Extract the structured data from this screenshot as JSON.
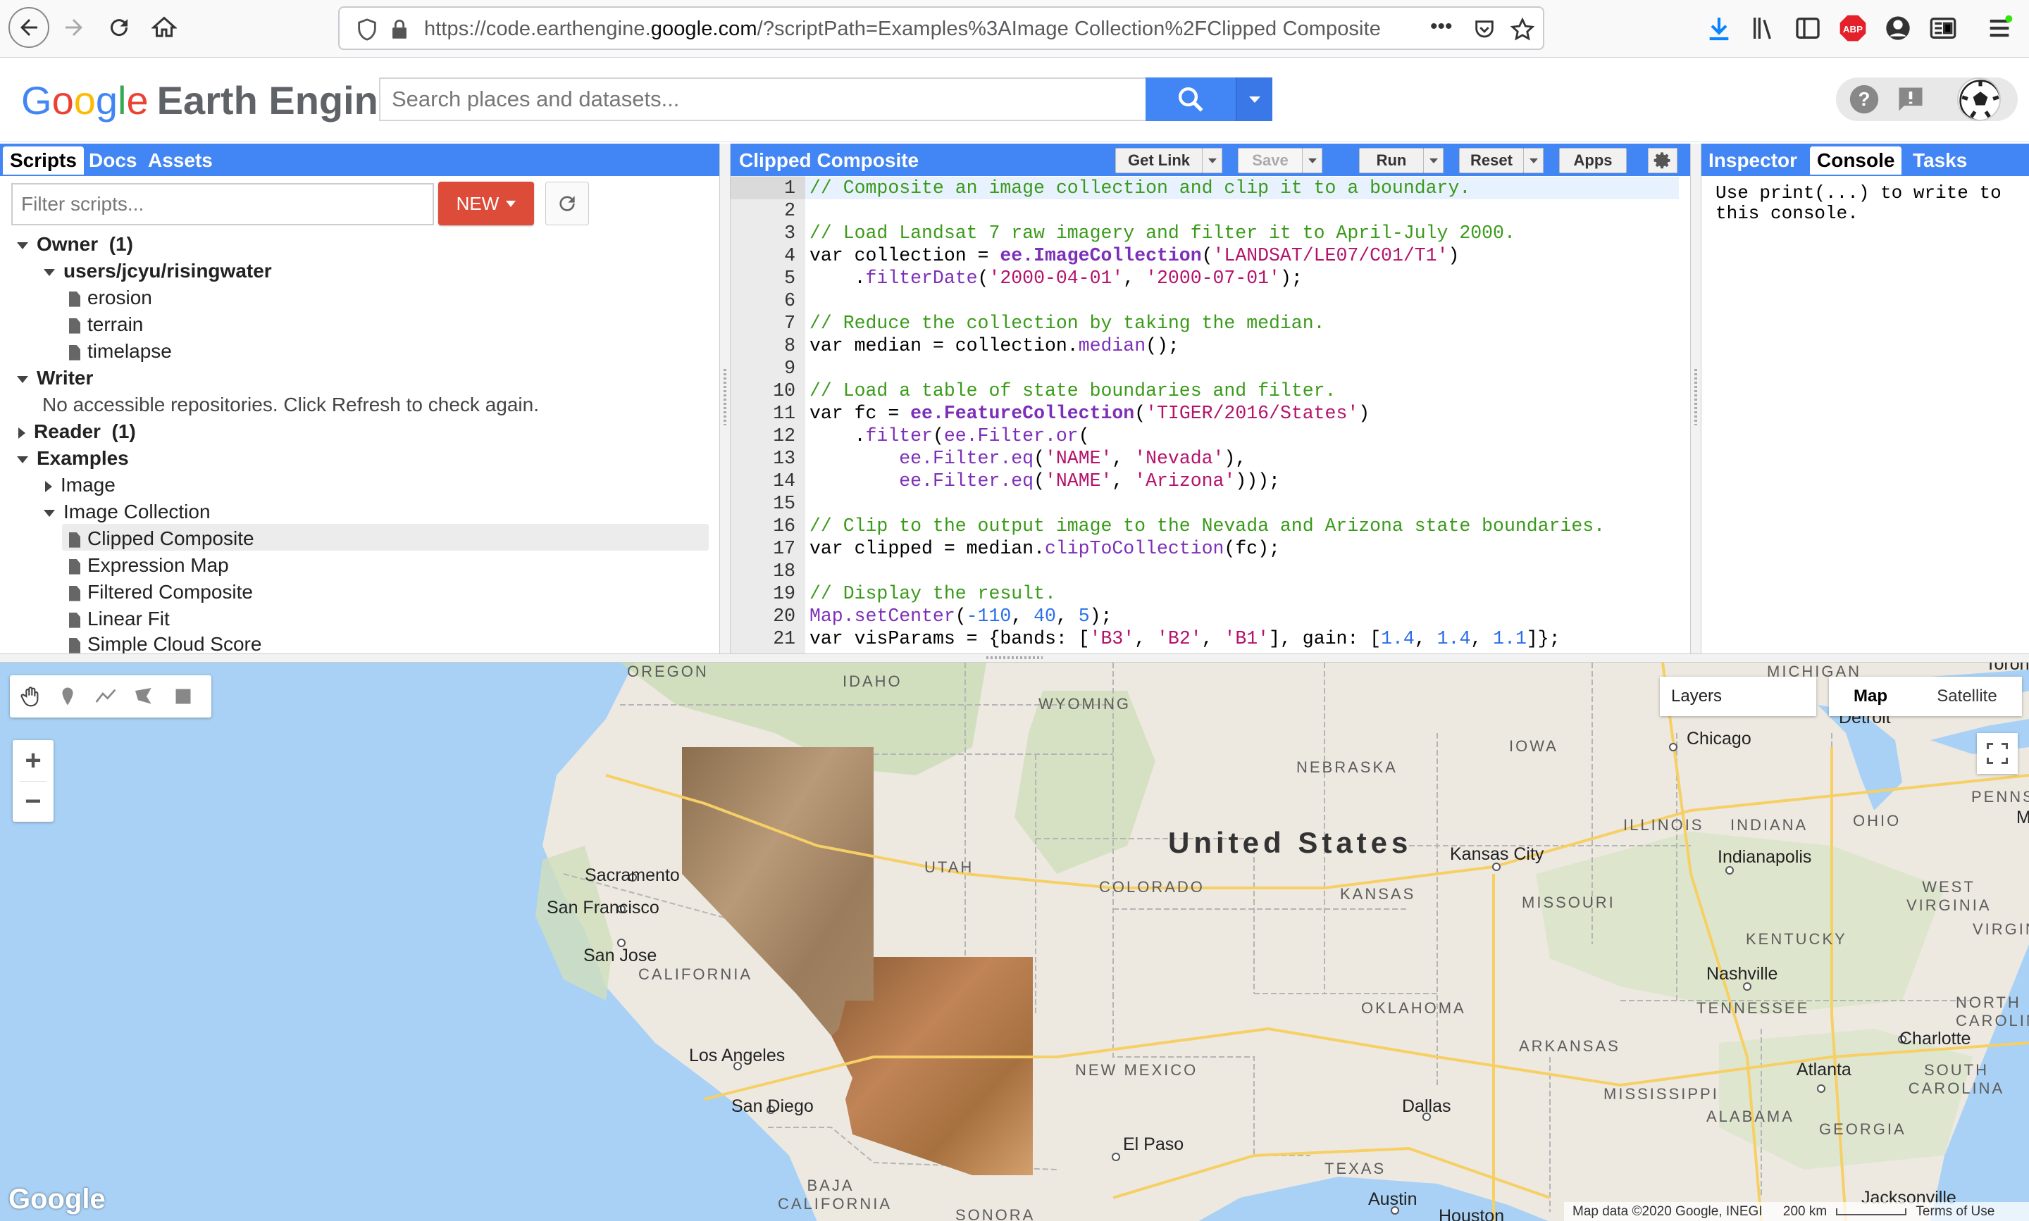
{
  "browser": {
    "url_prefix": "https://code.earthengine.",
    "url_domain": "google.com",
    "url_suffix": "/?scriptPath=Examples%3AImage Collection%2FClipped Composite",
    "more_label": "•••"
  },
  "header": {
    "logo_google": [
      "G",
      "o",
      "o",
      "g",
      "l",
      "e"
    ],
    "logo_product": "Earth Engine",
    "search_placeholder": "Search places and datasets..."
  },
  "left_panel": {
    "tabs": [
      "Scripts",
      "Docs",
      "Assets"
    ],
    "filter_placeholder": "Filter scripts...",
    "new_label": "NEW",
    "tree": [
      {
        "label": "Owner",
        "count": "(1)"
      },
      {
        "label": "users/jcyu/risingwater"
      },
      {
        "label": "erosion"
      },
      {
        "label": "terrain"
      },
      {
        "label": "timelapse"
      },
      {
        "label": "Writer"
      },
      {
        "label": "No accessible repositories. Click Refresh to check again."
      },
      {
        "label": "Reader",
        "count": "(1)"
      },
      {
        "label": "Examples"
      },
      {
        "label": "Image"
      },
      {
        "label": "Image Collection"
      },
      {
        "label": "Clipped Composite"
      },
      {
        "label": "Expression Map"
      },
      {
        "label": "Filtered Composite"
      },
      {
        "label": "Linear Fit"
      },
      {
        "label": "Simple Cloud Score"
      }
    ]
  },
  "editor": {
    "title": "Clipped Composite",
    "buttons": {
      "get_link": "Get Link",
      "save": "Save",
      "run": "Run",
      "reset": "Reset",
      "apps": "Apps"
    },
    "line_numbers": [
      "1",
      "2",
      "3",
      "4",
      "5",
      "6",
      "7",
      "8",
      "9",
      "10",
      "11",
      "12",
      "13",
      "14",
      "15",
      "16",
      "17",
      "18",
      "19",
      "20",
      "21"
    ]
  },
  "right_panel": {
    "tabs": [
      "Inspector",
      "Console",
      "Tasks"
    ],
    "console_text": "Use print(...) to write to this console."
  },
  "map": {
    "country": "United States",
    "states": [
      "OREGON",
      "IDAHO",
      "WYOMING",
      "NEBRASKA",
      "IOWA",
      "ILLINOIS",
      "INDIANA",
      "OHIO",
      "UTAH",
      "COLORADO",
      "KANSAS",
      "MISSOURI",
      "CALIFORNIA",
      "KENTUCKY",
      "OKLAHOMA",
      "TENNESSEE",
      "ARKANSAS",
      "NEW MEXICO",
      "MISSISSIPPI",
      "ALABAMA",
      "GEORGIA",
      "TEXAS",
      "MICHIGAN",
      "PENNS",
      "WEST VIRGINIA",
      "VIRGINI",
      "NORTH CAROLIN",
      "SOUTH CAROLINA",
      "BAJA CALIFORNIA",
      "SONORA"
    ],
    "cities": [
      "Sacramento",
      "San Francisco",
      "San Jose",
      "Los Angeles",
      "San Diego",
      "Chicago",
      "Detroit",
      "Kansas City",
      "Indianapolis",
      "Nashville",
      "Charlotte",
      "Atlanta",
      "Dallas",
      "El Paso",
      "Austin",
      "Houston",
      "Jacksonville",
      "Toronto",
      "Mi"
    ],
    "layers_label": "Layers",
    "map_types": [
      "Map",
      "Satellite"
    ],
    "google_logo": "Google",
    "attribution": "Map data ©2020 Google, INEGI",
    "scale_label": "200 km",
    "terms": "Terms of Use"
  }
}
